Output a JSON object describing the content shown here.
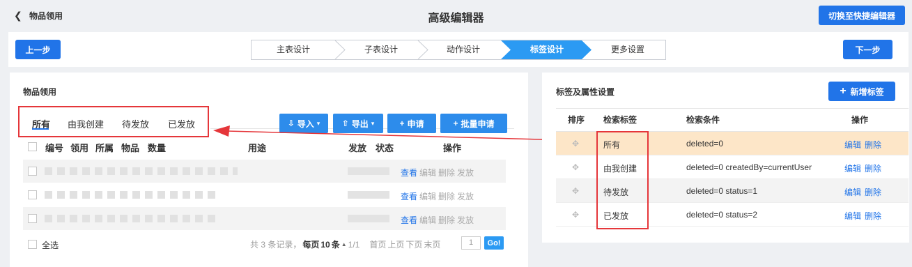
{
  "header": {
    "back_label": "物品领用",
    "title": "高级编辑器",
    "switch_label": "切换至快捷编辑器"
  },
  "nav": {
    "prev_label": "上一步",
    "next_label": "下一步"
  },
  "steps": [
    "主表设计",
    "子表设计",
    "动作设计",
    "标签设计",
    "更多设置"
  ],
  "left": {
    "title": "物品领用",
    "tabs": [
      "所有",
      "由我创建",
      "待发放",
      "已发放"
    ],
    "toolbar": {
      "import": "导入",
      "export": "导出",
      "apply": "申请",
      "batch_apply": "批量申请"
    },
    "columns": [
      "编号",
      "领用",
      "所属",
      "物品",
      "数量",
      "用途",
      "发放",
      "状态",
      "操作"
    ],
    "row_actions": [
      "查看",
      "编辑",
      "删除",
      "发放"
    ],
    "select_all": "全选",
    "pager": {
      "summary": "共 3 条记录，",
      "per_page": "每页",
      "size": "10",
      "unit": "条",
      "pages": "1/1",
      "first": "首页",
      "prev": "上页",
      "next": "下页",
      "last": "末页",
      "page_input": "1",
      "go": "Go!"
    }
  },
  "right": {
    "title": "标签及属性设置",
    "add_label": "新增标签",
    "columns": [
      "排序",
      "检索标签",
      "检索条件",
      "操作"
    ],
    "rows": [
      {
        "label": "所有",
        "condition": "deleted=0"
      },
      {
        "label": "由我创建",
        "condition": "deleted=0 createdBy=currentUser"
      },
      {
        "label": "待发放",
        "condition": "deleted=0 status=1"
      },
      {
        "label": "已发放",
        "condition": "deleted=0 status=2"
      }
    ],
    "edit": "编辑",
    "delete": "删除"
  },
  "colors": {
    "primary": "#2174e8",
    "active_step": "#2b9af3",
    "highlight": "#e5363a",
    "row_highlight": "#fde6c8"
  }
}
